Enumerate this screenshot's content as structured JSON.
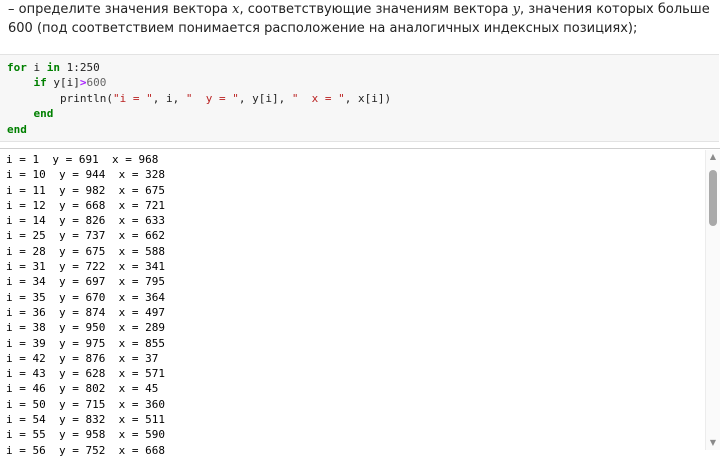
{
  "task": {
    "part1": "– определите значения вектора ",
    "var_x": "x",
    "part2": ", соответствующие значениям вектора ",
    "var_y": "y",
    "part3": ", значения которых больше 600 (под соответствием понимается расположение на аналогичных индексных позициях);"
  },
  "code": {
    "l1_kw_for": "for",
    "l1_var": " i ",
    "l1_kw_in": "in",
    "l1_range": " 1:250",
    "l2_indent": "    ",
    "l2_kw_if": "if",
    "l2_cond": " y[i]",
    "l2_op": ">",
    "l2_num": "600",
    "l3_indent": "        ",
    "l3_fn": "println(",
    "l3_s1": "\"i = \"",
    "l3_a1": ", i, ",
    "l3_s2": "\"  y = \"",
    "l3_a2": ", y[i], ",
    "l3_s3": "\"  x = \"",
    "l3_a3": ", x[i])",
    "l4_indent": "    ",
    "l4_kw_end": "end",
    "l5_kw_end": "end"
  },
  "output": {
    "rows": [
      "i = 1  y = 691  x = 968",
      "i = 10  y = 944  x = 328",
      "i = 11  y = 982  x = 675",
      "i = 12  y = 668  x = 721",
      "i = 14  y = 826  x = 633",
      "i = 25  y = 737  x = 662",
      "i = 28  y = 675  x = 588",
      "i = 31  y = 722  x = 341",
      "i = 34  y = 697  x = 795",
      "i = 35  y = 670  x = 364",
      "i = 36  y = 874  x = 497",
      "i = 38  y = 950  x = 289",
      "i = 39  y = 975  x = 855",
      "i = 42  y = 876  x = 37",
      "i = 43  y = 628  x = 571",
      "i = 46  y = 802  x = 45",
      "i = 50  y = 715  x = 360",
      "i = 54  y = 832  x = 511",
      "i = 55  y = 958  x = 590",
      "i = 56  y = 752  x = 668"
    ]
  },
  "scrollbar": {
    "up_icon": "triangle-up",
    "down_icon": "triangle-down"
  }
}
